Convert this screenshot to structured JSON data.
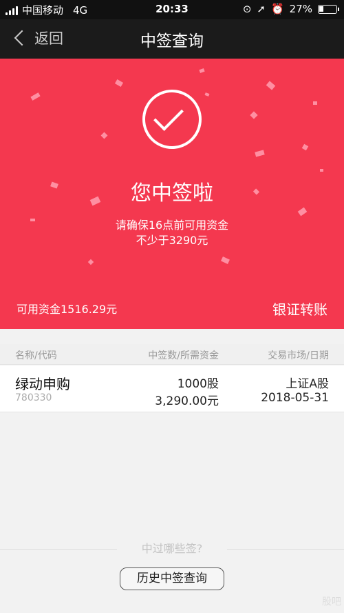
{
  "status_bar": {
    "carrier": "中国移动",
    "network": "4G",
    "time": "20:33",
    "battery": "27%",
    "battery_level": 0.27
  },
  "nav": {
    "back_label": "返回",
    "title": "中签查询"
  },
  "hero": {
    "title": "您中签啦",
    "message_line1": "请确保16点前可用资金",
    "message_line2": "不少于3290元",
    "available_funds": "可用资金1516.29元",
    "transfer_label": "银证转账"
  },
  "table": {
    "headers": {
      "name_code": "名称/代码",
      "count_funds": "中签数/所需资金",
      "market_date": "交易市场/日期"
    },
    "rows": [
      {
        "name": "绿动申购",
        "code": "780330",
        "quantity": "1000股",
        "amount": "3,290.00元",
        "market": "上证A股",
        "date": "2018-05-31"
      }
    ]
  },
  "footer": {
    "hint": "中过哪些签?",
    "history_button": "历史中签查询",
    "watermark": "股吧"
  },
  "colors": {
    "accent": "#f4384f",
    "nav": "#1b1b1b"
  }
}
